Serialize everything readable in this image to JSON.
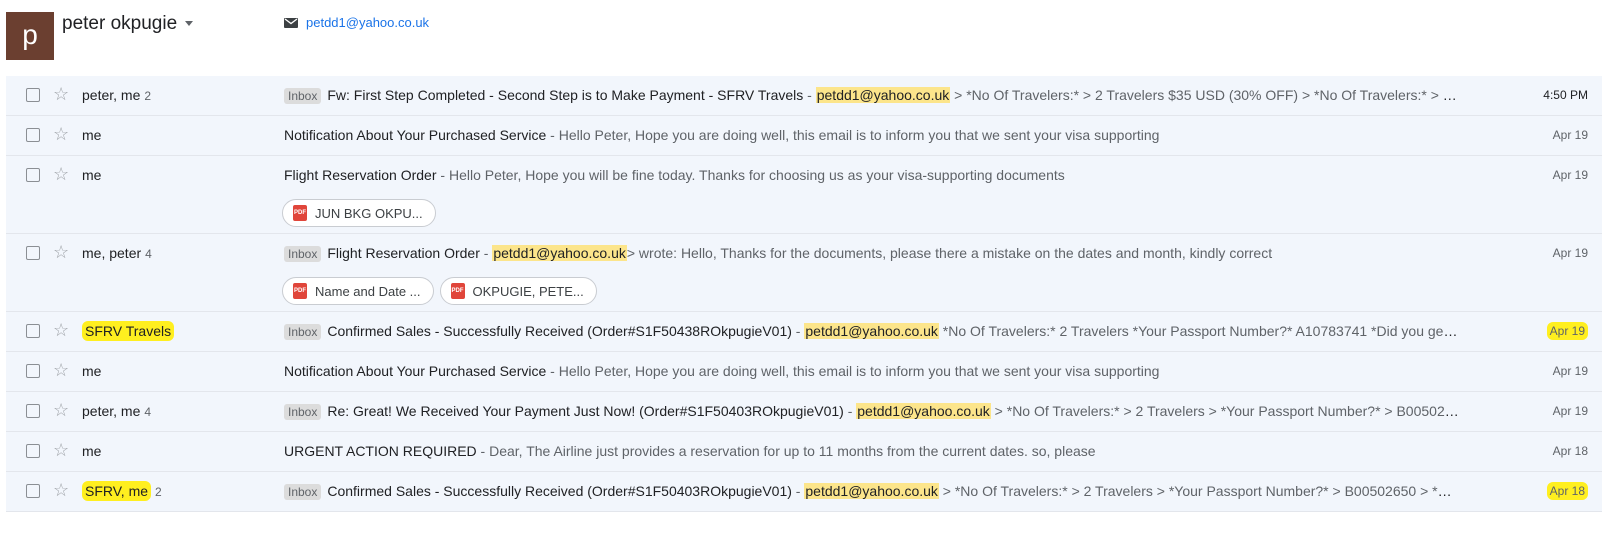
{
  "header": {
    "avatar_letter": "p",
    "owner_name": "peter okpugie",
    "contact_email": "petdd1@yahoo.co.uk"
  },
  "colors": {
    "highlight": "#fbe74a",
    "email_highlight": "#fce58b",
    "avatar": "#6b3f30",
    "row_bg": "#f2f6fc"
  },
  "emails": [
    {
      "sender": "peter, me",
      "count": "2",
      "badge": "Inbox",
      "subject": "Fw: First Step Completed - Second Step is to Make Payment - SFRV Travels",
      "sep": " - ",
      "email": "petdd1@yahoo.co.uk",
      "snippet": " > *No Of Travelers:* > 2 Travelers $35 USD (30% OFF) > *No Of Travelers:* > 2 Travel...",
      "date": "4:50 PM"
    },
    {
      "sender": "me",
      "subject": "Notification About Your Purchased Service",
      "snippet": " - Hello Peter, Hope you are doing well, this email is to inform you that we sent your visa supporting",
      "date": "Apr 19"
    },
    {
      "sender": "me",
      "subject": "Flight Reservation Order",
      "snippet": " - Hello Peter, Hope you will be fine today. Thanks for choosing us as your visa-supporting documents",
      "date": "Apr 19",
      "attachments": [
        "JUN BKG OKPU..."
      ]
    },
    {
      "sender": "me, peter",
      "count": "4",
      "badge": "Inbox",
      "subject": "Flight Reservation Order",
      "sep": " - ",
      "email": "petdd1@yahoo.co.uk",
      "snippet": "> wrote: Hello, Thanks for the documents, please there a mistake on the dates and month, kindly correct",
      "date": "Apr 19",
      "attachments": [
        "Name and Date ...",
        "OKPUGIE, PETE..."
      ]
    },
    {
      "sender": "SFRV Travels",
      "badge": "Inbox",
      "subject": "Confirmed Sales - Successfully Received (Order#S1F50438ROkpugieV01)",
      "sep": " - ",
      "email": "petdd1@yahoo.co.uk",
      "snippet": " *No Of Travelers:* 2 Travelers *Your Passport Number?* A10783741 *Did you get visa ...",
      "date": "Apr 19"
    },
    {
      "sender": "me",
      "subject": "Notification About Your Purchased Service",
      "snippet": " - Hello Peter, Hope you are doing well, this email is to inform you that we sent your visa supporting",
      "date": "Apr 19"
    },
    {
      "sender": "peter, me",
      "count": "4",
      "badge": "Inbox",
      "subject": "Re: Great! We Received Your Payment Just Now! (Order#S1F50403ROkpugieV01)",
      "sep": " - ",
      "email": "petdd1@yahoo.co.uk",
      "snippet": " > *No Of Travelers:* > 2 Travelers > *Your Passport Number?* > B00502650 > ...",
      "date": "Apr 19"
    },
    {
      "sender": "me",
      "subject": "URGENT ACTION REQUIRED",
      "snippet": " - Dear, The Airline just provides a reservation for up to 11 months from the current dates. so, please",
      "date": "Apr 18"
    },
    {
      "sender": "SFRV, me",
      "count": "2",
      "badge": "Inbox",
      "subject": "Confirmed Sales - Successfully Received (Order#S1F50403ROkpugieV01)",
      "sep": " - ",
      "email": "petdd1@yahoo.co.uk",
      "snippet": " > *No Of Travelers:* > 2 Travelers > *Your Passport Number?* > B00502650 > *Did you",
      "date": "Apr 18"
    }
  ]
}
